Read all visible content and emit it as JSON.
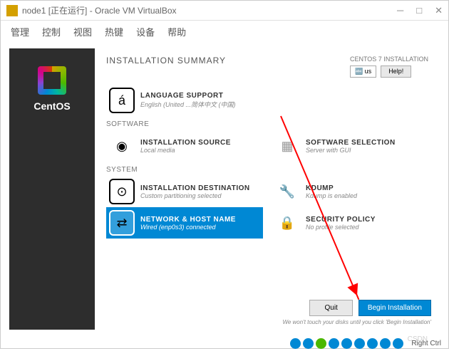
{
  "window": {
    "title": "node1 [正在运行] - Oracle VM VirtualBox",
    "menu": [
      "管理",
      "控制",
      "视图",
      "热键",
      "设备",
      "帮助"
    ]
  },
  "installer": {
    "brand": "CentOS",
    "title": "INSTALLATION SUMMARY",
    "subtitle": "CENTOS 7 INSTALLATION",
    "lang_indicator": "🔤 us",
    "help": "Help!",
    "sections": {
      "localization": {
        "lang_support": {
          "title": "LANGUAGE SUPPORT",
          "sub": "English (United ...简体中文 (中国)"
        }
      },
      "software_label": "SOFTWARE",
      "software": {
        "source": {
          "title": "INSTALLATION SOURCE",
          "sub": "Local media"
        },
        "selection": {
          "title": "SOFTWARE SELECTION",
          "sub": "Server with GUI"
        }
      },
      "system_label": "SYSTEM",
      "system": {
        "dest": {
          "title": "INSTALLATION DESTINATION",
          "sub": "Custom partitioning selected"
        },
        "kdump": {
          "title": "KDUMP",
          "sub": "Kdump is enabled"
        },
        "network": {
          "title": "NETWORK & HOST NAME",
          "sub": "Wired (enp0s3) connected"
        },
        "security": {
          "title": "SECURITY POLICY",
          "sub": "No profile selected"
        }
      }
    },
    "buttons": {
      "quit": "Quit",
      "begin": "Begin Installation"
    },
    "note": "We won't touch your disks until you click 'Begin Installation'"
  },
  "statusbar": {
    "host_key": "Right Ctrl"
  },
  "watermark": "CSDN"
}
